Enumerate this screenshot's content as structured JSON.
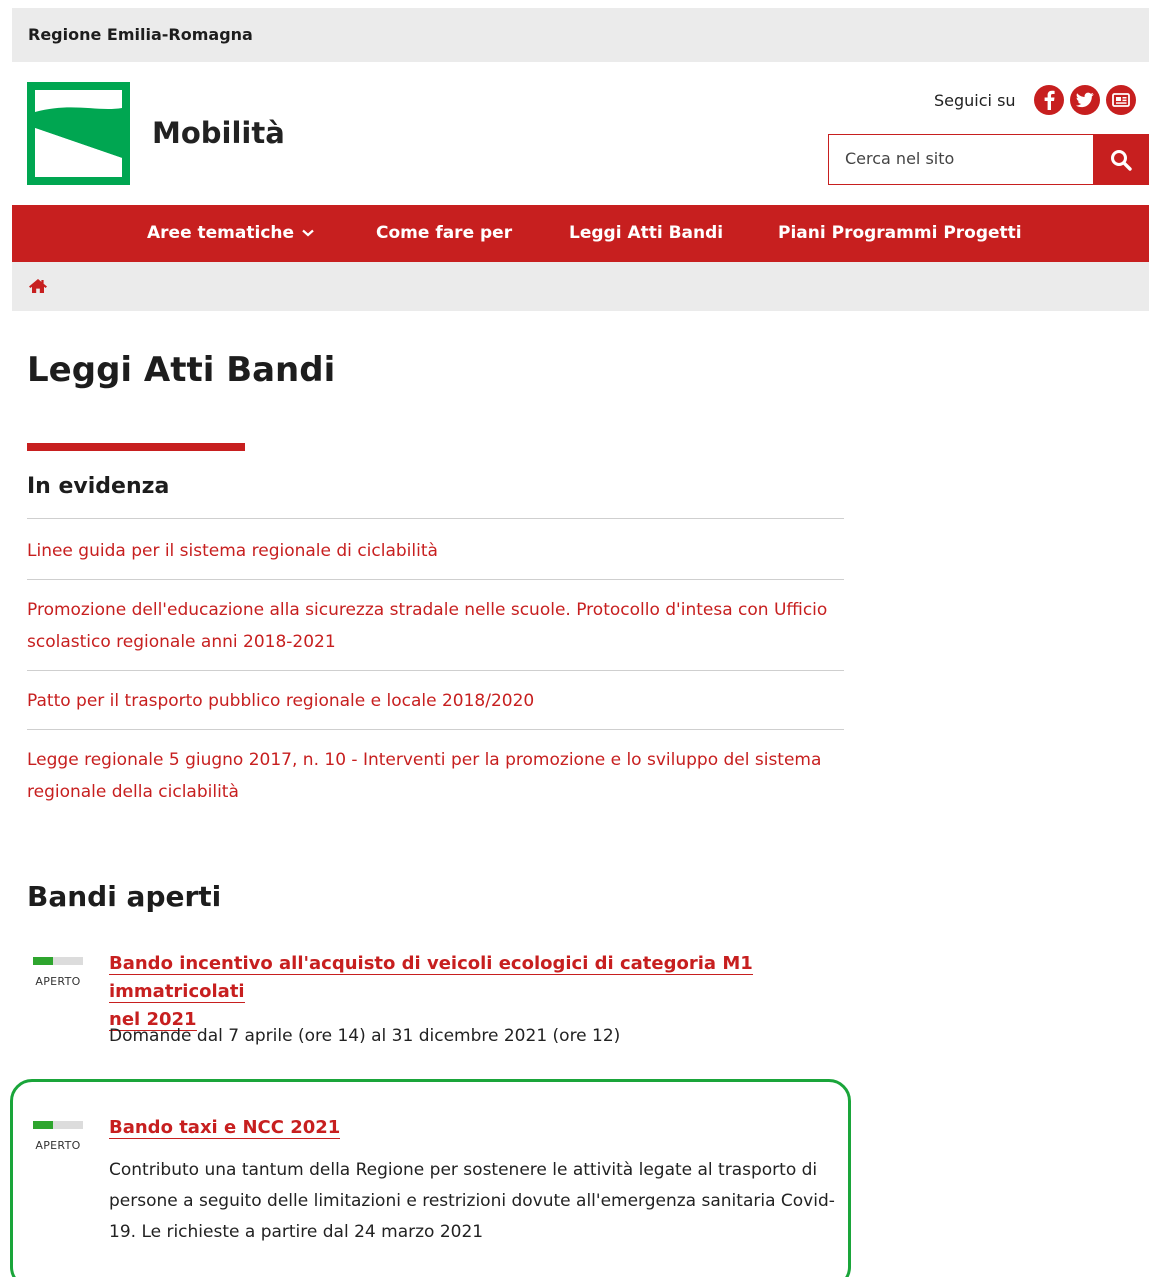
{
  "topbar": {
    "region": "Regione Emilia-Romagna"
  },
  "site": {
    "title": "Mobilità"
  },
  "follow": {
    "label": "Seguici su",
    "icons": [
      "facebook-icon",
      "twitter-icon",
      "newsletter-icon"
    ]
  },
  "search": {
    "placeholder": "Cerca nel sito"
  },
  "nav": {
    "items": [
      {
        "label": "Aree tematiche"
      },
      {
        "label": "Come fare per"
      },
      {
        "label": "Leggi Atti Bandi"
      },
      {
        "label": "Piani Programmi Progetti"
      }
    ]
  },
  "main": {
    "title": "Leggi Atti Bandi",
    "highlights_title": "In evidenza",
    "highlights": [
      "Linee guida per il sistema regionale di ciclabilità",
      "Promozione dell'educazione alla sicurezza stradale nelle scuole. Protocollo d'intesa con Ufficio scolastico regionale anni 2018-2021",
      "Patto per il trasporto pubblico regionale e locale 2018/2020",
      "Legge regionale 5 giugno 2017, n. 10 - Interventi per la promozione e lo sviluppo del sistema regionale della ciclabilità"
    ],
    "bandi_title": "Bandi aperti",
    "bandi": [
      {
        "status": "APERTO",
        "title_line1": "Bando incentivo all'acquisto di veicoli ecologici di categoria M1 immatricolati",
        "title_line2": "nel 2021",
        "description": "Domande dal 7 aprile (ore 14) al 31 dicembre 2021 (ore 12)"
      },
      {
        "status": "APERTO",
        "title_line1": "Bando taxi e NCC 2021",
        "description": "Contributo una tantum della Regione per sostenere le attività legate al trasporto di persone a seguito delle limitazioni e restrizioni dovute all'emergenza sanitaria Covid-19. Le richieste a partire dal 24 marzo 2021"
      }
    ]
  },
  "colors": {
    "brand_red": "#c71f1f",
    "logo_green": "#00a651",
    "status_green": "#2ea52e",
    "highlight_green": "#1aa53a"
  }
}
